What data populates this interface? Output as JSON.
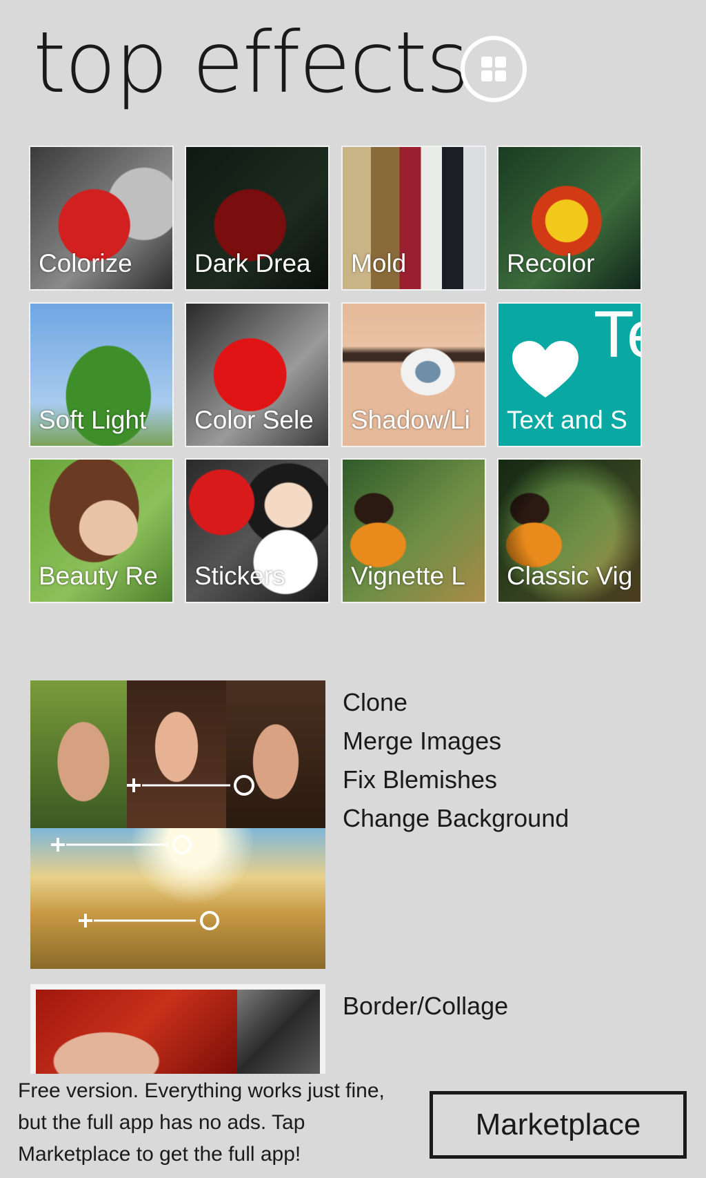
{
  "header": {
    "title": "top effects",
    "grid_icon": "grid-icon"
  },
  "effects": [
    {
      "label": "Colorize"
    },
    {
      "label": "Dark Drea"
    },
    {
      "label": "Mold"
    },
    {
      "label": "Recolor"
    },
    {
      "label": "Soft Light"
    },
    {
      "label": "Color Sele"
    },
    {
      "label": "Shadow/Li"
    },
    {
      "label": "Text and S"
    },
    {
      "label": "Beauty Re"
    },
    {
      "label": "Stickers"
    },
    {
      "label": "Vignette L"
    },
    {
      "label": "Classic Vig"
    }
  ],
  "text_tile_glyph": "Te",
  "promo1": {
    "items": [
      "Clone",
      "Merge Images",
      "Fix Blemishes",
      "Change Background"
    ]
  },
  "promo2": {
    "items": [
      "Border/Collage"
    ]
  },
  "footer": {
    "note": "Free version. Everything works just fine, but the full app has no ads. Tap Marketplace to get the full app!",
    "button": "Marketplace"
  }
}
